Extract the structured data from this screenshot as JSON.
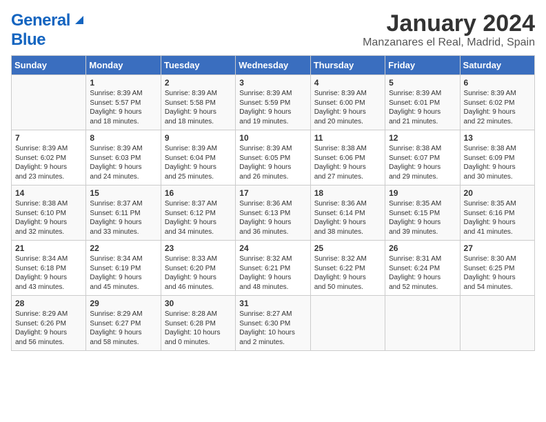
{
  "header": {
    "logo_general": "General",
    "logo_blue": "Blue",
    "month": "January 2024",
    "location": "Manzanares el Real, Madrid, Spain"
  },
  "days_of_week": [
    "Sunday",
    "Monday",
    "Tuesday",
    "Wednesday",
    "Thursday",
    "Friday",
    "Saturday"
  ],
  "weeks": [
    [
      {
        "day": "",
        "content": ""
      },
      {
        "day": "1",
        "content": "Sunrise: 8:39 AM\nSunset: 5:57 PM\nDaylight: 9 hours\nand 18 minutes."
      },
      {
        "day": "2",
        "content": "Sunrise: 8:39 AM\nSunset: 5:58 PM\nDaylight: 9 hours\nand 18 minutes."
      },
      {
        "day": "3",
        "content": "Sunrise: 8:39 AM\nSunset: 5:59 PM\nDaylight: 9 hours\nand 19 minutes."
      },
      {
        "day": "4",
        "content": "Sunrise: 8:39 AM\nSunset: 6:00 PM\nDaylight: 9 hours\nand 20 minutes."
      },
      {
        "day": "5",
        "content": "Sunrise: 8:39 AM\nSunset: 6:01 PM\nDaylight: 9 hours\nand 21 minutes."
      },
      {
        "day": "6",
        "content": "Sunrise: 8:39 AM\nSunset: 6:02 PM\nDaylight: 9 hours\nand 22 minutes."
      }
    ],
    [
      {
        "day": "7",
        "content": "Sunrise: 8:39 AM\nSunset: 6:02 PM\nDaylight: 9 hours\nand 23 minutes."
      },
      {
        "day": "8",
        "content": "Sunrise: 8:39 AM\nSunset: 6:03 PM\nDaylight: 9 hours\nand 24 minutes."
      },
      {
        "day": "9",
        "content": "Sunrise: 8:39 AM\nSunset: 6:04 PM\nDaylight: 9 hours\nand 25 minutes."
      },
      {
        "day": "10",
        "content": "Sunrise: 8:39 AM\nSunset: 6:05 PM\nDaylight: 9 hours\nand 26 minutes."
      },
      {
        "day": "11",
        "content": "Sunrise: 8:38 AM\nSunset: 6:06 PM\nDaylight: 9 hours\nand 27 minutes."
      },
      {
        "day": "12",
        "content": "Sunrise: 8:38 AM\nSunset: 6:07 PM\nDaylight: 9 hours\nand 29 minutes."
      },
      {
        "day": "13",
        "content": "Sunrise: 8:38 AM\nSunset: 6:09 PM\nDaylight: 9 hours\nand 30 minutes."
      }
    ],
    [
      {
        "day": "14",
        "content": "Sunrise: 8:38 AM\nSunset: 6:10 PM\nDaylight: 9 hours\nand 32 minutes."
      },
      {
        "day": "15",
        "content": "Sunrise: 8:37 AM\nSunset: 6:11 PM\nDaylight: 9 hours\nand 33 minutes."
      },
      {
        "day": "16",
        "content": "Sunrise: 8:37 AM\nSunset: 6:12 PM\nDaylight: 9 hours\nand 34 minutes."
      },
      {
        "day": "17",
        "content": "Sunrise: 8:36 AM\nSunset: 6:13 PM\nDaylight: 9 hours\nand 36 minutes."
      },
      {
        "day": "18",
        "content": "Sunrise: 8:36 AM\nSunset: 6:14 PM\nDaylight: 9 hours\nand 38 minutes."
      },
      {
        "day": "19",
        "content": "Sunrise: 8:35 AM\nSunset: 6:15 PM\nDaylight: 9 hours\nand 39 minutes."
      },
      {
        "day": "20",
        "content": "Sunrise: 8:35 AM\nSunset: 6:16 PM\nDaylight: 9 hours\nand 41 minutes."
      }
    ],
    [
      {
        "day": "21",
        "content": "Sunrise: 8:34 AM\nSunset: 6:18 PM\nDaylight: 9 hours\nand 43 minutes."
      },
      {
        "day": "22",
        "content": "Sunrise: 8:34 AM\nSunset: 6:19 PM\nDaylight: 9 hours\nand 45 minutes."
      },
      {
        "day": "23",
        "content": "Sunrise: 8:33 AM\nSunset: 6:20 PM\nDaylight: 9 hours\nand 46 minutes."
      },
      {
        "day": "24",
        "content": "Sunrise: 8:32 AM\nSunset: 6:21 PM\nDaylight: 9 hours\nand 48 minutes."
      },
      {
        "day": "25",
        "content": "Sunrise: 8:32 AM\nSunset: 6:22 PM\nDaylight: 9 hours\nand 50 minutes."
      },
      {
        "day": "26",
        "content": "Sunrise: 8:31 AM\nSunset: 6:24 PM\nDaylight: 9 hours\nand 52 minutes."
      },
      {
        "day": "27",
        "content": "Sunrise: 8:30 AM\nSunset: 6:25 PM\nDaylight: 9 hours\nand 54 minutes."
      }
    ],
    [
      {
        "day": "28",
        "content": "Sunrise: 8:29 AM\nSunset: 6:26 PM\nDaylight: 9 hours\nand 56 minutes."
      },
      {
        "day": "29",
        "content": "Sunrise: 8:29 AM\nSunset: 6:27 PM\nDaylight: 9 hours\nand 58 minutes."
      },
      {
        "day": "30",
        "content": "Sunrise: 8:28 AM\nSunset: 6:28 PM\nDaylight: 10 hours\nand 0 minutes."
      },
      {
        "day": "31",
        "content": "Sunrise: 8:27 AM\nSunset: 6:30 PM\nDaylight: 10 hours\nand 2 minutes."
      },
      {
        "day": "",
        "content": ""
      },
      {
        "day": "",
        "content": ""
      },
      {
        "day": "",
        "content": ""
      }
    ]
  ]
}
